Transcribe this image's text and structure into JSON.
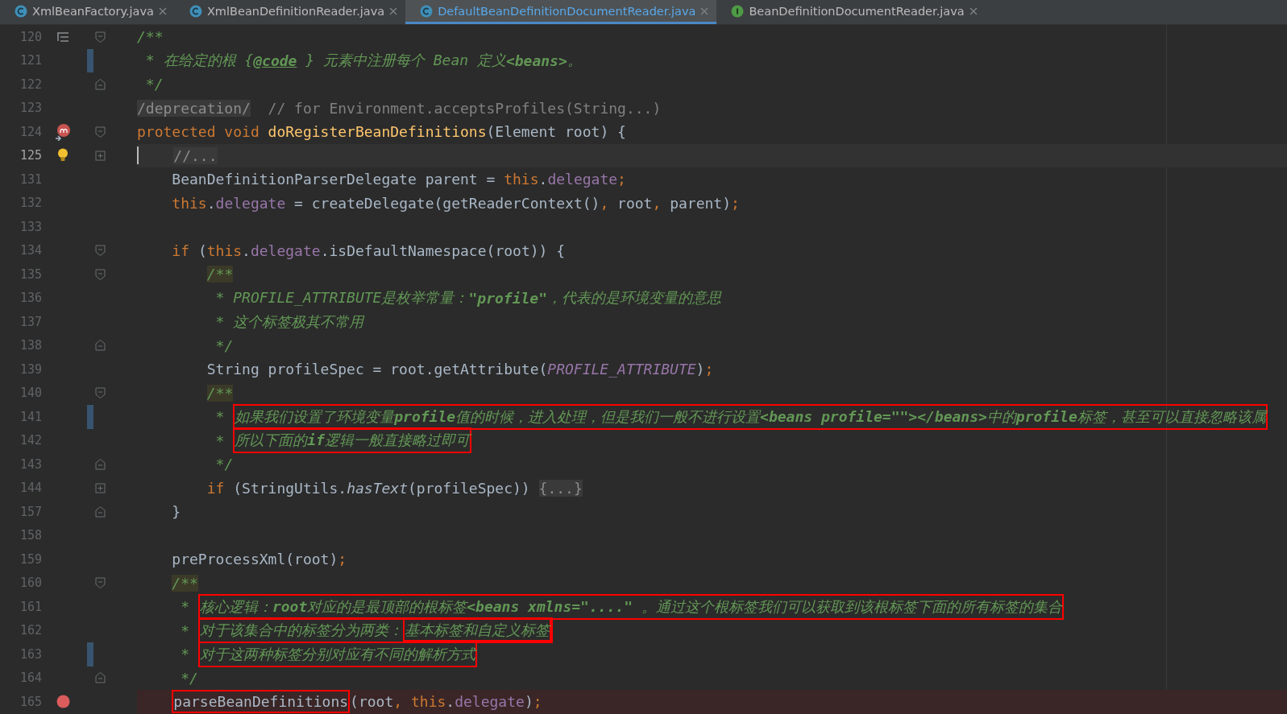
{
  "tabs": [
    {
      "label": "XmlBeanFactory.java",
      "kind": "class",
      "selected": false
    },
    {
      "label": "XmlBeanDefinitionReader.java",
      "kind": "class",
      "selected": false
    },
    {
      "label": "DefaultBeanDefinitionDocumentReader.java",
      "kind": "class",
      "selected": true
    },
    {
      "label": "BeanDefinitionDocumentReader.java",
      "kind": "interface",
      "selected": false
    }
  ],
  "lines": [
    {
      "number": "120",
      "fold": {
        "kind": "open"
      },
      "marker": {
        "kind": "structure"
      },
      "tokens": [
        {
          "text": "/**",
          "kind": "doc"
        }
      ]
    },
    {
      "number": "121",
      "changed": true,
      "tokens": [
        {
          "text": " * 在给定的根 {",
          "kind": "doc"
        },
        {
          "text": "@code",
          "kind": "doc-tag"
        },
        {
          "text": " } 元素中注册每个 Bean 定义",
          "kind": "doc"
        },
        {
          "text": "<beans>",
          "kind": "doc-strong"
        },
        {
          "text": "。",
          "kind": "doc"
        }
      ]
    },
    {
      "number": "122",
      "fold": {
        "kind": "close"
      },
      "tokens": [
        {
          "text": " */",
          "kind": "doc"
        }
      ]
    },
    {
      "number": "123",
      "tokens": [
        {
          "text": "/deprecation/",
          "kind": "folded"
        },
        {
          "text": "  // for Environment.acceptsProfiles(String...)",
          "kind": "comment"
        }
      ]
    },
    {
      "number": "124",
      "fold": {
        "kind": "open"
      },
      "marker": {
        "kind": "override"
      },
      "tokens": [
        {
          "text": "protected void ",
          "kind": "keyword"
        },
        {
          "text": "doRegisterBeanDefinitions",
          "kind": "decl"
        },
        {
          "text": "(Element root) {",
          "kind": "plain"
        }
      ]
    },
    {
      "number": "125",
      "current": true,
      "fold": {
        "kind": "collapsed"
      },
      "marker": {
        "kind": "bulb"
      },
      "tokens": [
        {
          "text": "    //...",
          "kind": "folded"
        }
      ]
    },
    {
      "number": "131",
      "tokens": [
        {
          "text": "    BeanDefinitionParserDelegate parent = ",
          "kind": "plain"
        },
        {
          "text": "this",
          "kind": "keyword"
        },
        {
          "text": ".",
          "kind": "plain"
        },
        {
          "text": "delegate",
          "kind": "field"
        },
        {
          "text": ";",
          "kind": "keyword"
        }
      ]
    },
    {
      "number": "132",
      "tokens": [
        {
          "text": "    this",
          "kind": "keyword"
        },
        {
          "text": ".",
          "kind": "plain"
        },
        {
          "text": "delegate",
          "kind": "field"
        },
        {
          "text": " = createDelegate(getReaderContext()",
          "kind": "plain"
        },
        {
          "text": ",",
          "kind": "keyword"
        },
        {
          "text": " root",
          "kind": "plain"
        },
        {
          "text": ",",
          "kind": "keyword"
        },
        {
          "text": " parent)",
          "kind": "plain"
        },
        {
          "text": ";",
          "kind": "keyword"
        }
      ]
    },
    {
      "number": "133"
    },
    {
      "number": "134",
      "fold": {
        "kind": "open"
      },
      "tokens": [
        {
          "text": "    if",
          "kind": "keyword"
        },
        {
          "text": " (",
          "kind": "plain"
        },
        {
          "text": "this",
          "kind": "keyword"
        },
        {
          "text": ".",
          "kind": "plain"
        },
        {
          "text": "delegate",
          "kind": "field"
        },
        {
          "text": ".isDefaultNamespace(root)) {",
          "kind": "plain"
        }
      ]
    },
    {
      "number": "135",
      "fold": {
        "kind": "open"
      },
      "tokens": [
        {
          "text": "        /**",
          "kind": "doc-marked"
        }
      ]
    },
    {
      "number": "136",
      "tokens": [
        {
          "text": "         * PROFILE_ATTRIBUTE是枚举常量：",
          "kind": "doc"
        },
        {
          "text": "\"profile\"",
          "kind": "doc-strong"
        },
        {
          "text": "，代表的是环境变量的意思",
          "kind": "doc"
        }
      ]
    },
    {
      "number": "137",
      "tokens": [
        {
          "text": "         * 这个标签极其不常用",
          "kind": "doc"
        }
      ]
    },
    {
      "number": "138",
      "fold": {
        "kind": "close"
      },
      "tokens": [
        {
          "text": "         */",
          "kind": "doc"
        }
      ]
    },
    {
      "number": "139",
      "tokens": [
        {
          "text": "        String profileSpec = root.getAttribute(",
          "kind": "plain"
        },
        {
          "text": "PROFILE_ATTRIBUTE",
          "kind": "const"
        },
        {
          "text": ")",
          "kind": "plain"
        },
        {
          "text": ";",
          "kind": "keyword"
        }
      ]
    },
    {
      "number": "140",
      "fold": {
        "kind": "open"
      },
      "tokens": [
        {
          "text": "        /**",
          "kind": "doc-marked"
        }
      ]
    },
    {
      "number": "141",
      "changed": true,
      "tokens": [
        {
          "text": "         * ",
          "kind": "doc"
        },
        {
          "boxed": true,
          "parts": [
            {
              "text": "如果我们设置了环境变量",
              "kind": "doc"
            },
            {
              "text": "profile",
              "kind": "doc-strong"
            },
            {
              "text": "值的时候，进入处理，但是我们一般不进行设置",
              "kind": "doc"
            },
            {
              "text": "<beans profile=\"\"></beans>",
              "kind": "doc-strong"
            },
            {
              "text": "中的",
              "kind": "doc"
            },
            {
              "text": "profile",
              "kind": "doc-strong"
            },
            {
              "text": "标签，甚至可以直接忽略该属",
              "kind": "doc"
            }
          ]
        }
      ]
    },
    {
      "number": "142",
      "tokens": [
        {
          "text": "         * ",
          "kind": "doc"
        },
        {
          "boxed": true,
          "parts": [
            {
              "text": "所以下面的",
              "kind": "doc"
            },
            {
              "text": "if",
              "kind": "doc-strong"
            },
            {
              "text": "逻辑一般直接略过即可",
              "kind": "doc"
            }
          ]
        }
      ]
    },
    {
      "number": "143",
      "fold": {
        "kind": "close"
      },
      "tokens": [
        {
          "text": "         */",
          "kind": "doc"
        }
      ]
    },
    {
      "number": "144",
      "fold": {
        "kind": "collapsed"
      },
      "tokens": [
        {
          "text": "        if",
          "kind": "keyword"
        },
        {
          "text": " (StringUtils.",
          "kind": "plain"
        },
        {
          "text": "hasText",
          "kind": "static"
        },
        {
          "text": "(profileSpec)) ",
          "kind": "plain"
        },
        {
          "text": "{...}",
          "kind": "folded"
        }
      ]
    },
    {
      "number": "157",
      "fold": {
        "kind": "close"
      },
      "tokens": [
        {
          "text": "    }",
          "kind": "plain"
        }
      ]
    },
    {
      "number": "158"
    },
    {
      "number": "159",
      "tokens": [
        {
          "text": "    preProcessXml(root)",
          "kind": "plain"
        },
        {
          "text": ";",
          "kind": "keyword"
        }
      ]
    },
    {
      "number": "160",
      "fold": {
        "kind": "open"
      },
      "tokens": [
        {
          "text": "    /**",
          "kind": "doc-marked"
        }
      ]
    },
    {
      "number": "161",
      "tokens": [
        {
          "text": "     * ",
          "kind": "doc"
        },
        {
          "boxed": true,
          "parts": [
            {
              "text": "核心逻辑：",
              "kind": "doc"
            },
            {
              "text": "root",
              "kind": "doc-strong"
            },
            {
              "text": "对应的是最顶部的根标签",
              "kind": "doc"
            },
            {
              "text": "<beans xmlns=\"....\"",
              "kind": "doc-strong"
            },
            {
              "text": " 。通过这个根标签我们可以获取到该根标签下面的所有标签的集合",
              "kind": "doc"
            }
          ]
        }
      ]
    },
    {
      "number": "162",
      "tokens": [
        {
          "text": "     * ",
          "kind": "doc"
        },
        {
          "boxed": true,
          "parts": [
            {
              "text": "对于该集合中的标签分为两类：",
              "kind": "doc"
            },
            {
              "boxed": true,
              "parts": [
                {
                  "text": "基本标签和自定义标签",
                  "kind": "doc"
                }
              ]
            }
          ]
        }
      ]
    },
    {
      "number": "163",
      "changed": true,
      "tokens": [
        {
          "text": "     * ",
          "kind": "doc"
        },
        {
          "boxed": true,
          "parts": [
            {
              "text": "对于这两种标签分别对应有不同的解析方式",
              "kind": "doc"
            }
          ]
        }
      ]
    },
    {
      "number": "164",
      "fold": {
        "kind": "close"
      },
      "tokens": [
        {
          "text": "     */",
          "kind": "doc"
        }
      ]
    },
    {
      "number": "165",
      "marker": {
        "kind": "breakpoint"
      },
      "tokens": [
        {
          "boxed": true,
          "parts": [
            {
              "text": "    parseBeanDefinitions",
              "kind": "plain"
            }
          ]
        },
        {
          "text": "(root",
          "kind": "plain"
        },
        {
          "text": ", ",
          "kind": "keyword"
        },
        {
          "text": "this",
          "kind": "keyword"
        },
        {
          "text": ".",
          "kind": "plain"
        },
        {
          "text": "delegate",
          "kind": "field"
        },
        {
          "text": ")",
          "kind": "plain"
        },
        {
          "text": ";",
          "kind": "keyword"
        }
      ]
    }
  ]
}
